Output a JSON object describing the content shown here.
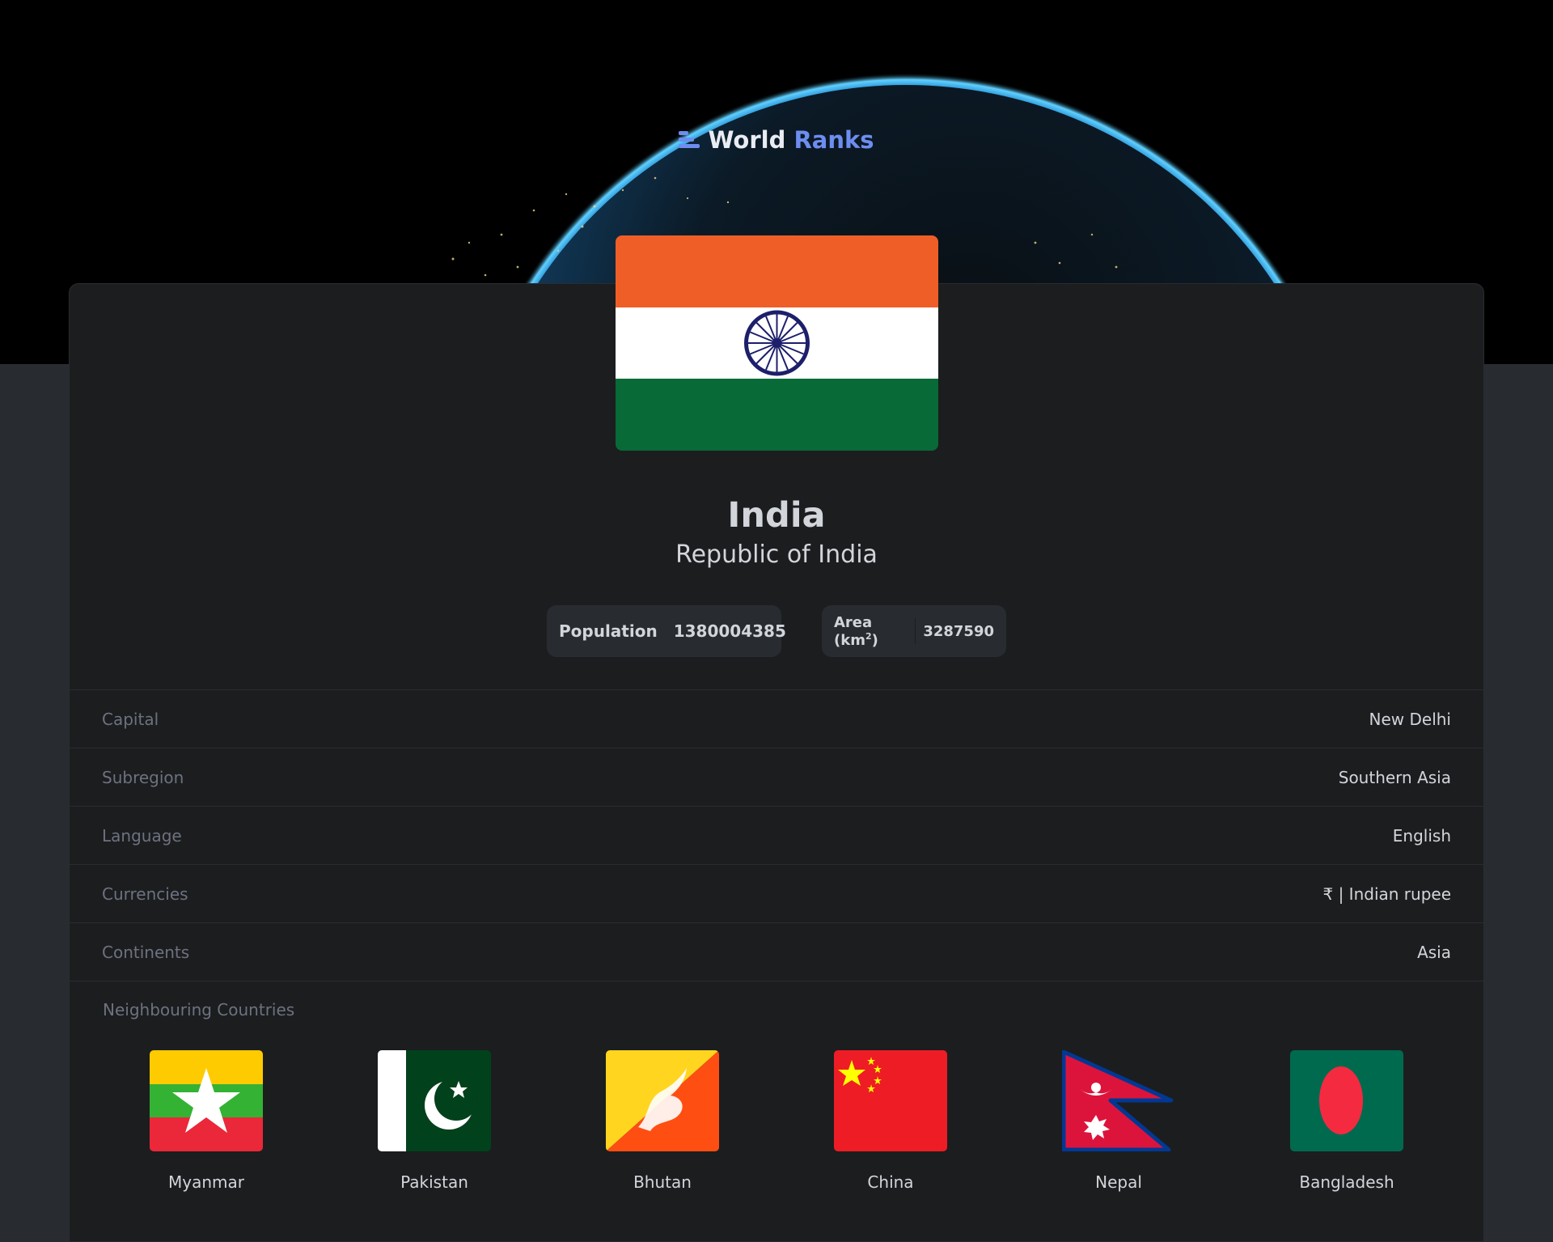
{
  "app": {
    "brand_word1": "World",
    "brand_word2": "Ranks",
    "accent_color": "#6d8df0"
  },
  "country": {
    "name": "India",
    "official_name": "Republic of India",
    "flag_icon": "india-flag"
  },
  "stats": {
    "population_label": "Population",
    "population_value": "1380004385",
    "area_label": "Area (km",
    "area_unit_sup": "2",
    "area_label_close": ")",
    "area_value": "3287590"
  },
  "details": [
    {
      "label": "Capital",
      "value": "New Delhi"
    },
    {
      "label": "Subregion",
      "value": "Southern Asia"
    },
    {
      "label": "Language",
      "value": "English"
    },
    {
      "label": "Currencies",
      "value": "₹ | Indian rupee"
    },
    {
      "label": "Continents",
      "value": "Asia"
    }
  ],
  "neighbours": {
    "title": "Neighbouring Countries",
    "items": [
      {
        "name": "Myanmar",
        "flag_icon": "myanmar-flag"
      },
      {
        "name": "Pakistan",
        "flag_icon": "pakistan-flag"
      },
      {
        "name": "Bhutan",
        "flag_icon": "bhutan-flag"
      },
      {
        "name": "China",
        "flag_icon": "china-flag"
      },
      {
        "name": "Nepal",
        "flag_icon": "nepal-flag"
      },
      {
        "name": "Bangladesh",
        "flag_icon": "bangladesh-flag"
      }
    ]
  }
}
